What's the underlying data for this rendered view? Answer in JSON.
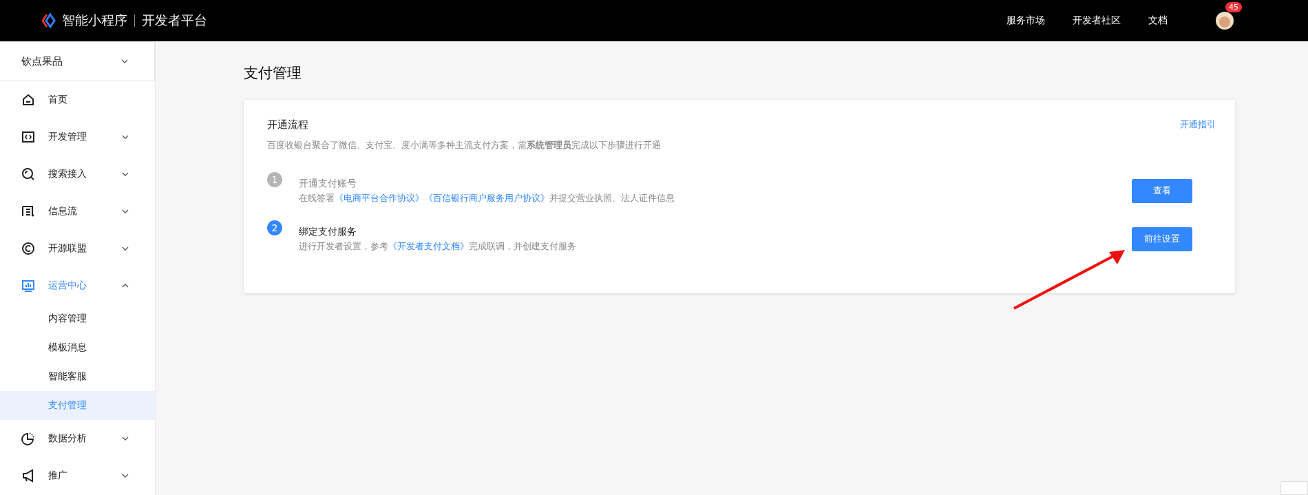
{
  "header": {
    "logo_text": "智能小程序",
    "platform": "开发者平台",
    "nav": [
      "服务市场",
      "开发者社区",
      "文档"
    ],
    "badge": "45"
  },
  "sidebar": {
    "app_selector": "钦点果品",
    "items": [
      {
        "label": "首页",
        "selected": false
      },
      {
        "label": "开发管理",
        "selected": false,
        "expanded": false
      },
      {
        "label": "搜索接入",
        "selected": false,
        "expanded": false
      },
      {
        "label": "信息流",
        "selected": false,
        "expanded": false
      },
      {
        "label": "开源联盟",
        "selected": false,
        "expanded": false
      },
      {
        "label": "运营中心",
        "selected": true,
        "expanded": true,
        "children": [
          {
            "label": "内容管理",
            "selected": false
          },
          {
            "label": "模板消息",
            "selected": false
          },
          {
            "label": "智能客服",
            "selected": false
          },
          {
            "label": "支付管理",
            "selected": true
          }
        ]
      },
      {
        "label": "数据分析",
        "selected": false,
        "expanded": false
      },
      {
        "label": "推广",
        "selected": false,
        "expanded": false
      }
    ]
  },
  "page": {
    "title": "支付管理",
    "card": {
      "title": "开通流程",
      "guide_link": "开通指引",
      "description": "百度收银台聚合了微信、支付宝、度小满等多种主流支付方案，需**系统管理员**完成以下步骤进行开通",
      "steps": [
        {
          "number": "1",
          "title": "开通支付账号",
          "active": false,
          "parts": [
            {
              "text": "在线签署",
              "kind": "text"
            },
            {
              "text": "《电商平台合作协议》",
              "kind": "link"
            },
            {
              "text": "《百信银行商户服务用户协议》",
              "kind": "link"
            },
            {
              "text": "并提交营业执照、法人证件信息",
              "kind": "text"
            }
          ],
          "button": "查看"
        },
        {
          "number": "2",
          "title": "绑定支付服务",
          "active": true,
          "parts": [
            {
              "text": "进行开发者设置，参考",
              "kind": "text"
            },
            {
              "text": "《开发者支付文档》",
              "kind": "link"
            },
            {
              "text": "完成联调，并创建支付服务",
              "kind": "text"
            }
          ],
          "button": "前往设置"
        }
      ]
    }
  }
}
